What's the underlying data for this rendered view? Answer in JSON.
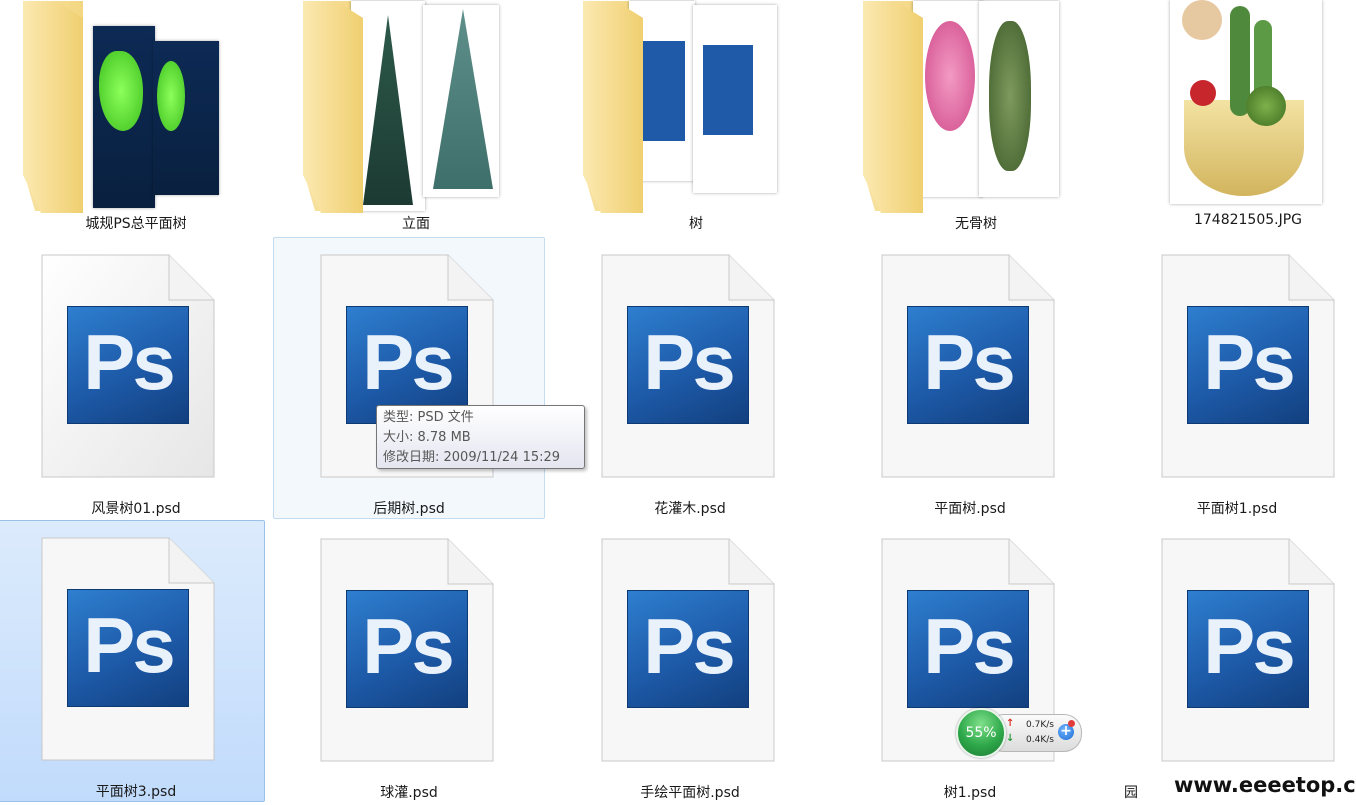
{
  "top_items": [
    {
      "label": "城规PS总平面树",
      "kind": "folder"
    },
    {
      "label": "立面",
      "kind": "folder"
    },
    {
      "label": "树",
      "kind": "folder"
    },
    {
      "label": "无骨树",
      "kind": "folder"
    },
    {
      "label": "174821505.JPG",
      "kind": "jpg"
    }
  ],
  "psd_files": [
    {
      "label": "风景树01.psd"
    },
    {
      "label": "后期树.psd"
    },
    {
      "label": "花灌木.psd"
    },
    {
      "label": "平面树.psd"
    },
    {
      "label": "平面树1.psd"
    },
    {
      "label": "平面树3.psd"
    },
    {
      "label": "球灌.psd"
    },
    {
      "label": "手绘平面树.psd"
    },
    {
      "label": "树1.psd"
    },
    {
      "label": "园"
    }
  ],
  "ps_icon_text": "Ps",
  "tooltip": {
    "type": "类型: PSD 文件",
    "size": "大小: 8.78 MB",
    "modified": "修改日期: 2009/11/24 15:29"
  },
  "net_widget": {
    "percent": "55%",
    "up_rate": "0.7K/s",
    "down_rate": "0.4K/s",
    "up_arrow": "↑",
    "down_arrow": "↓",
    "plus": "+"
  },
  "watermark": "www.eeeetop.com",
  "colors": {
    "ps_blue": "#1d5aa8",
    "selection": "#c1dbfc",
    "hover": "#f3f8fd"
  }
}
